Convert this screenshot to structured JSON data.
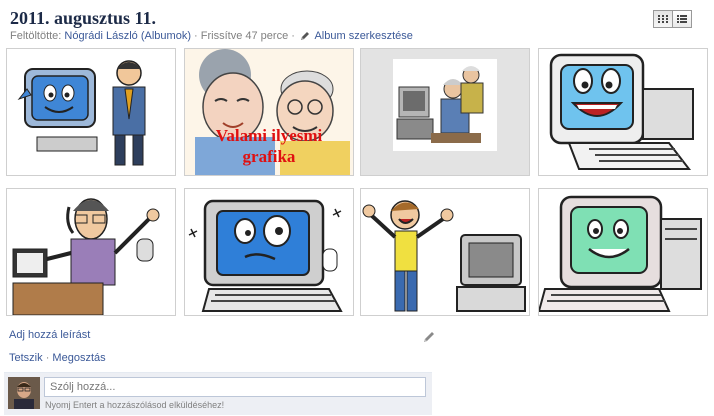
{
  "album": {
    "title": "2011. augusztus 11.",
    "uploaded_label": "Feltöltötte:",
    "uploader": "Nógrádi László (Albumok)",
    "separator": "·",
    "updated": "Frissítve 47 perce",
    "edit_album": "Album szerkesztése"
  },
  "view_toggle": {
    "grid_icon": "grid-view-icon",
    "list_icon": "list-view-icon",
    "active": "grid"
  },
  "photos": [
    {
      "name": "cartoon-computer-with-man",
      "icon": "photo-thumbnail"
    },
    {
      "name": "elderly-couple",
      "icon": "photo-thumbnail",
      "overlay_text": [
        "Valami ilyesmi",
        "grafika"
      ]
    },
    {
      "name": "elderly-couple-at-computer",
      "icon": "photo-thumbnail"
    },
    {
      "name": "smiling-computer",
      "icon": "photo-thumbnail"
    },
    {
      "name": "man-with-book",
      "icon": "photo-thumbnail"
    },
    {
      "name": "confused-computer",
      "icon": "photo-thumbnail"
    },
    {
      "name": "excited-man-computer",
      "icon": "photo-thumbnail"
    },
    {
      "name": "happy-green-computer",
      "icon": "photo-thumbnail"
    }
  ],
  "description": {
    "add_label": "Adj hozzá leírást",
    "edit_icon": "pencil-icon"
  },
  "actions": {
    "like": "Tetszik",
    "share": "Megosztás"
  },
  "comment": {
    "placeholder": "Szólj hozzá...",
    "hint": "Nyomj Entert a hozzászólásod elküldéséhez!"
  },
  "colors": {
    "link": "#3b5998",
    "title": "#1c2a47",
    "meta": "#808080",
    "comment_bg": "#edeff4"
  }
}
